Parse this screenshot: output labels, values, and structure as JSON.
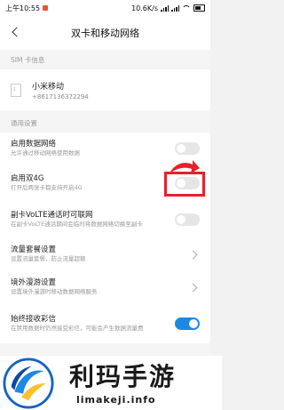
{
  "status_bar": {
    "time": "上午10:55",
    "network": "10.6K/s"
  },
  "header": {
    "title": "双卡和移动网络"
  },
  "sim_section": {
    "title": "SIM 卡信息",
    "sim_icon_text": "1",
    "sim_name": "小米移动",
    "sim_number": "+8617136372294"
  },
  "general_section": {
    "title": "通用设置"
  },
  "rows": [
    {
      "label": "启用数据网络",
      "desc": "允许通过移动网络使用数据",
      "control": "toggle",
      "on": false
    },
    {
      "label": "启用双4G",
      "desc": "打开后两张卡都支持开启4G",
      "control": "toggle",
      "on": false
    },
    {
      "label": "副卡VoLTE通话时可联网",
      "desc": "在副卡VoLTE通话期间会临时将数据网络切换至副卡",
      "control": "toggle",
      "on": false
    },
    {
      "label": "流量套餐设置",
      "desc": "设置流量套餐，防止流量超额",
      "control": "chevron"
    },
    {
      "label": "境外漫游设置",
      "desc": "设置境外漫游时移动数据网络服务",
      "control": "chevron"
    },
    {
      "label": "始终接收彩信",
      "desc": "在禁用数据时仍然接受彩信，可能会产生数据流量费",
      "control": "toggle",
      "on": true
    }
  ],
  "watermark": {
    "chinese": "利玛手游",
    "url": "limakeji.info"
  },
  "colors": {
    "accent": "#1e88e5",
    "highlight": "#e5212b"
  }
}
